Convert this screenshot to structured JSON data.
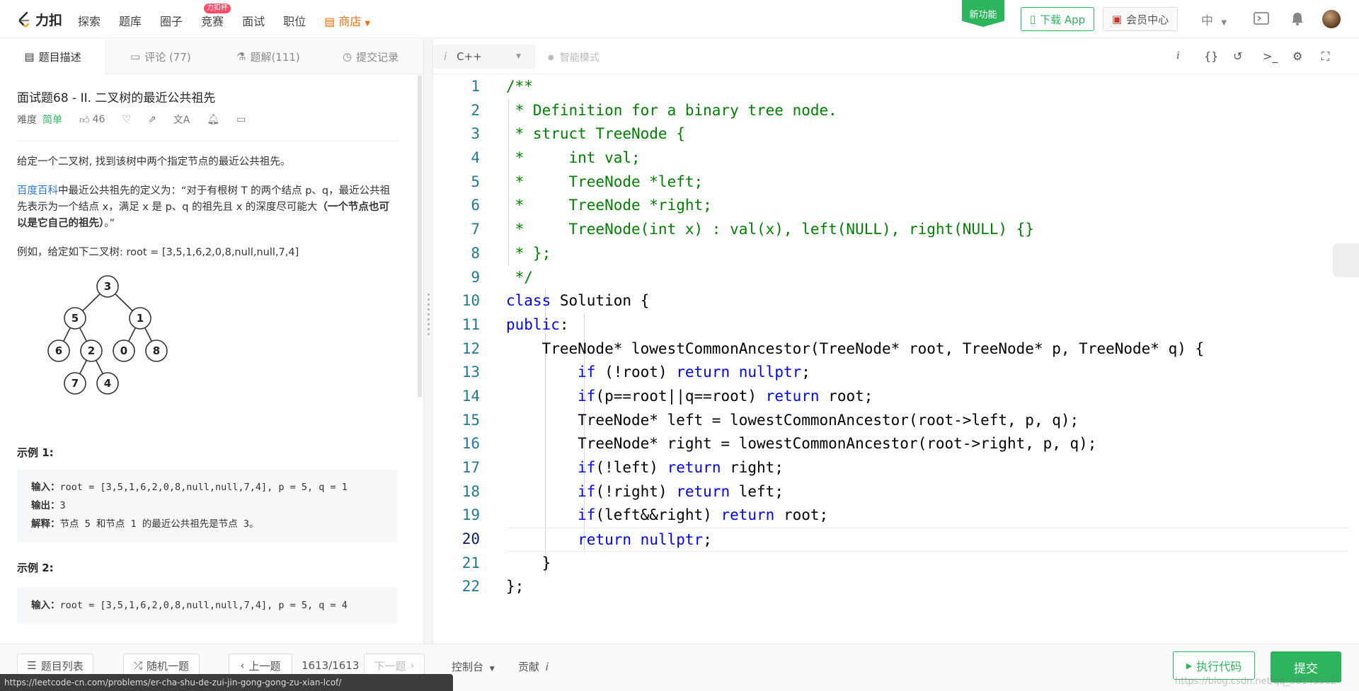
{
  "nav": {
    "logo_text": "力扣",
    "items": [
      "探索",
      "题库",
      "圈子",
      "竞赛",
      "面试",
      "职位"
    ],
    "contest_badge": "力扣杯",
    "shop": "商店",
    "new_feature": "新功能",
    "download_app": "下载 App",
    "member_center": "会员中心",
    "language": "中"
  },
  "left_tabs": {
    "description": "题目描述",
    "comments": "评论 (77)",
    "solutions": "题解(111)",
    "submissions": "提交记录"
  },
  "problem": {
    "title": "面试题68 - II. 二叉树的最近公共祖先",
    "difficulty_label": "难度",
    "difficulty": "简单",
    "likes": "46",
    "intro": "给定一个二叉树, 找到该树中两个指定节点的最近公共祖先。",
    "def_link": "百度百科",
    "def_text": "中最近公共祖先的定义为：“对于有根树 T 的两个结点 p、q，最近公共祖先表示为一个结点 x，满足 x 是 p、q 的祖先且 x 的深度尽可能大",
    "def_bold": "（一个节点也可以是它自己的祖先）",
    "def_end": "。”",
    "example_tree": "例如，给定如下二叉树:  root = [3,5,1,6,2,0,8,null,null,7,4]",
    "tree_nodes": [
      "3",
      "5",
      "1",
      "6",
      "2",
      "0",
      "8",
      "7",
      "4"
    ],
    "ex1_title": "示例 1:",
    "ex1": {
      "input_label": "输入",
      "input": "root = [3,5,1,6,2,0,8,null,null,7,4], p = 5, q = 1",
      "output_label": "输出",
      "output": "3",
      "explain_label": "解释",
      "explain": "节点 5 和节点 1 的最近公共祖先是节点 3。"
    },
    "ex2_title": "示例 2:",
    "ex2": {
      "input_label": "输入",
      "input": "root = [3,5,1,6,2,0,8,null,null,7,4], p = 5, q = 4"
    }
  },
  "editor": {
    "language": "C++",
    "smart_mode": "智能模式",
    "lines": [
      "1",
      "2",
      "3",
      "4",
      "5",
      "6",
      "7",
      "8",
      "9",
      "10",
      "11",
      "12",
      "13",
      "14",
      "15",
      "16",
      "17",
      "18",
      "19",
      "20",
      "21",
      "22"
    ]
  },
  "bottom": {
    "problem_list": "题目列表",
    "random": "随机一题",
    "prev": "上一题",
    "page": "1613/1613",
    "next": "下一题",
    "console": "控制台",
    "contribute": "贡献",
    "run": "执行代码",
    "submit": "提交"
  },
  "status_url": "https://leetcode-cn.com/problems/er-cha-shu-de-zui-jin-gong-gong-zu-xian-lcof/",
  "watermark": "https://blog.csdn.net/qq_38145502",
  "colors": {
    "accent": "#2db55d",
    "shop": "#f46d0d",
    "link": "#2e77d0"
  }
}
